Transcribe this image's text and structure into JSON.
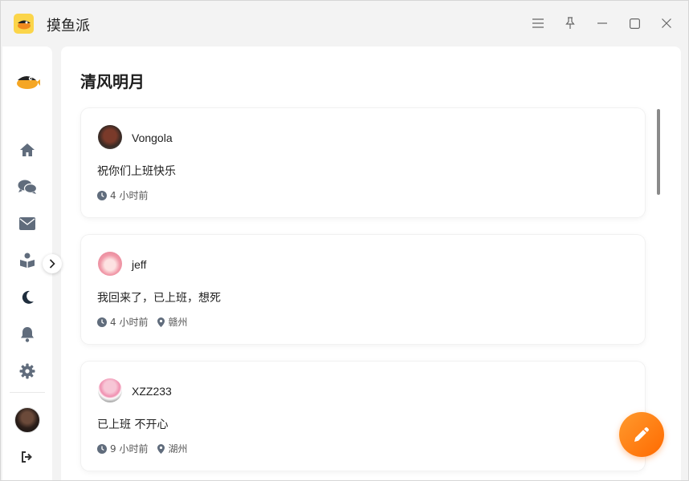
{
  "app": {
    "title": "摸鱼派",
    "logo_icon": "fish-icon",
    "brand_color": "#fbd54a"
  },
  "window_controls": [
    "menu-icon",
    "pin-icon",
    "minimize-icon",
    "maximize-icon",
    "close-icon"
  ],
  "sidebar": {
    "items": [
      {
        "icon": "home-icon"
      },
      {
        "icon": "chat-icon"
      },
      {
        "icon": "mail-icon"
      },
      {
        "icon": "book-reader-icon"
      },
      {
        "icon": "moon-icon",
        "active": true
      },
      {
        "icon": "bell-icon"
      },
      {
        "icon": "gear-icon"
      }
    ],
    "logout_icon": "logout-icon"
  },
  "main": {
    "title": "清风明月",
    "posts": [
      {
        "username": "Vongola",
        "content": "祝你们上班快乐",
        "time": "4 小时前",
        "location": ""
      },
      {
        "username": "jeff",
        "content": "我回来了，已上班，想死",
        "time": "4 小时前",
        "location": "赣州"
      },
      {
        "username": "XZZ233",
        "content": "已上班 不开心",
        "time": "9 小时前",
        "location": "湖州"
      }
    ]
  },
  "fab": {
    "icon": "pencil-icon",
    "color": "#ff7a1a"
  }
}
